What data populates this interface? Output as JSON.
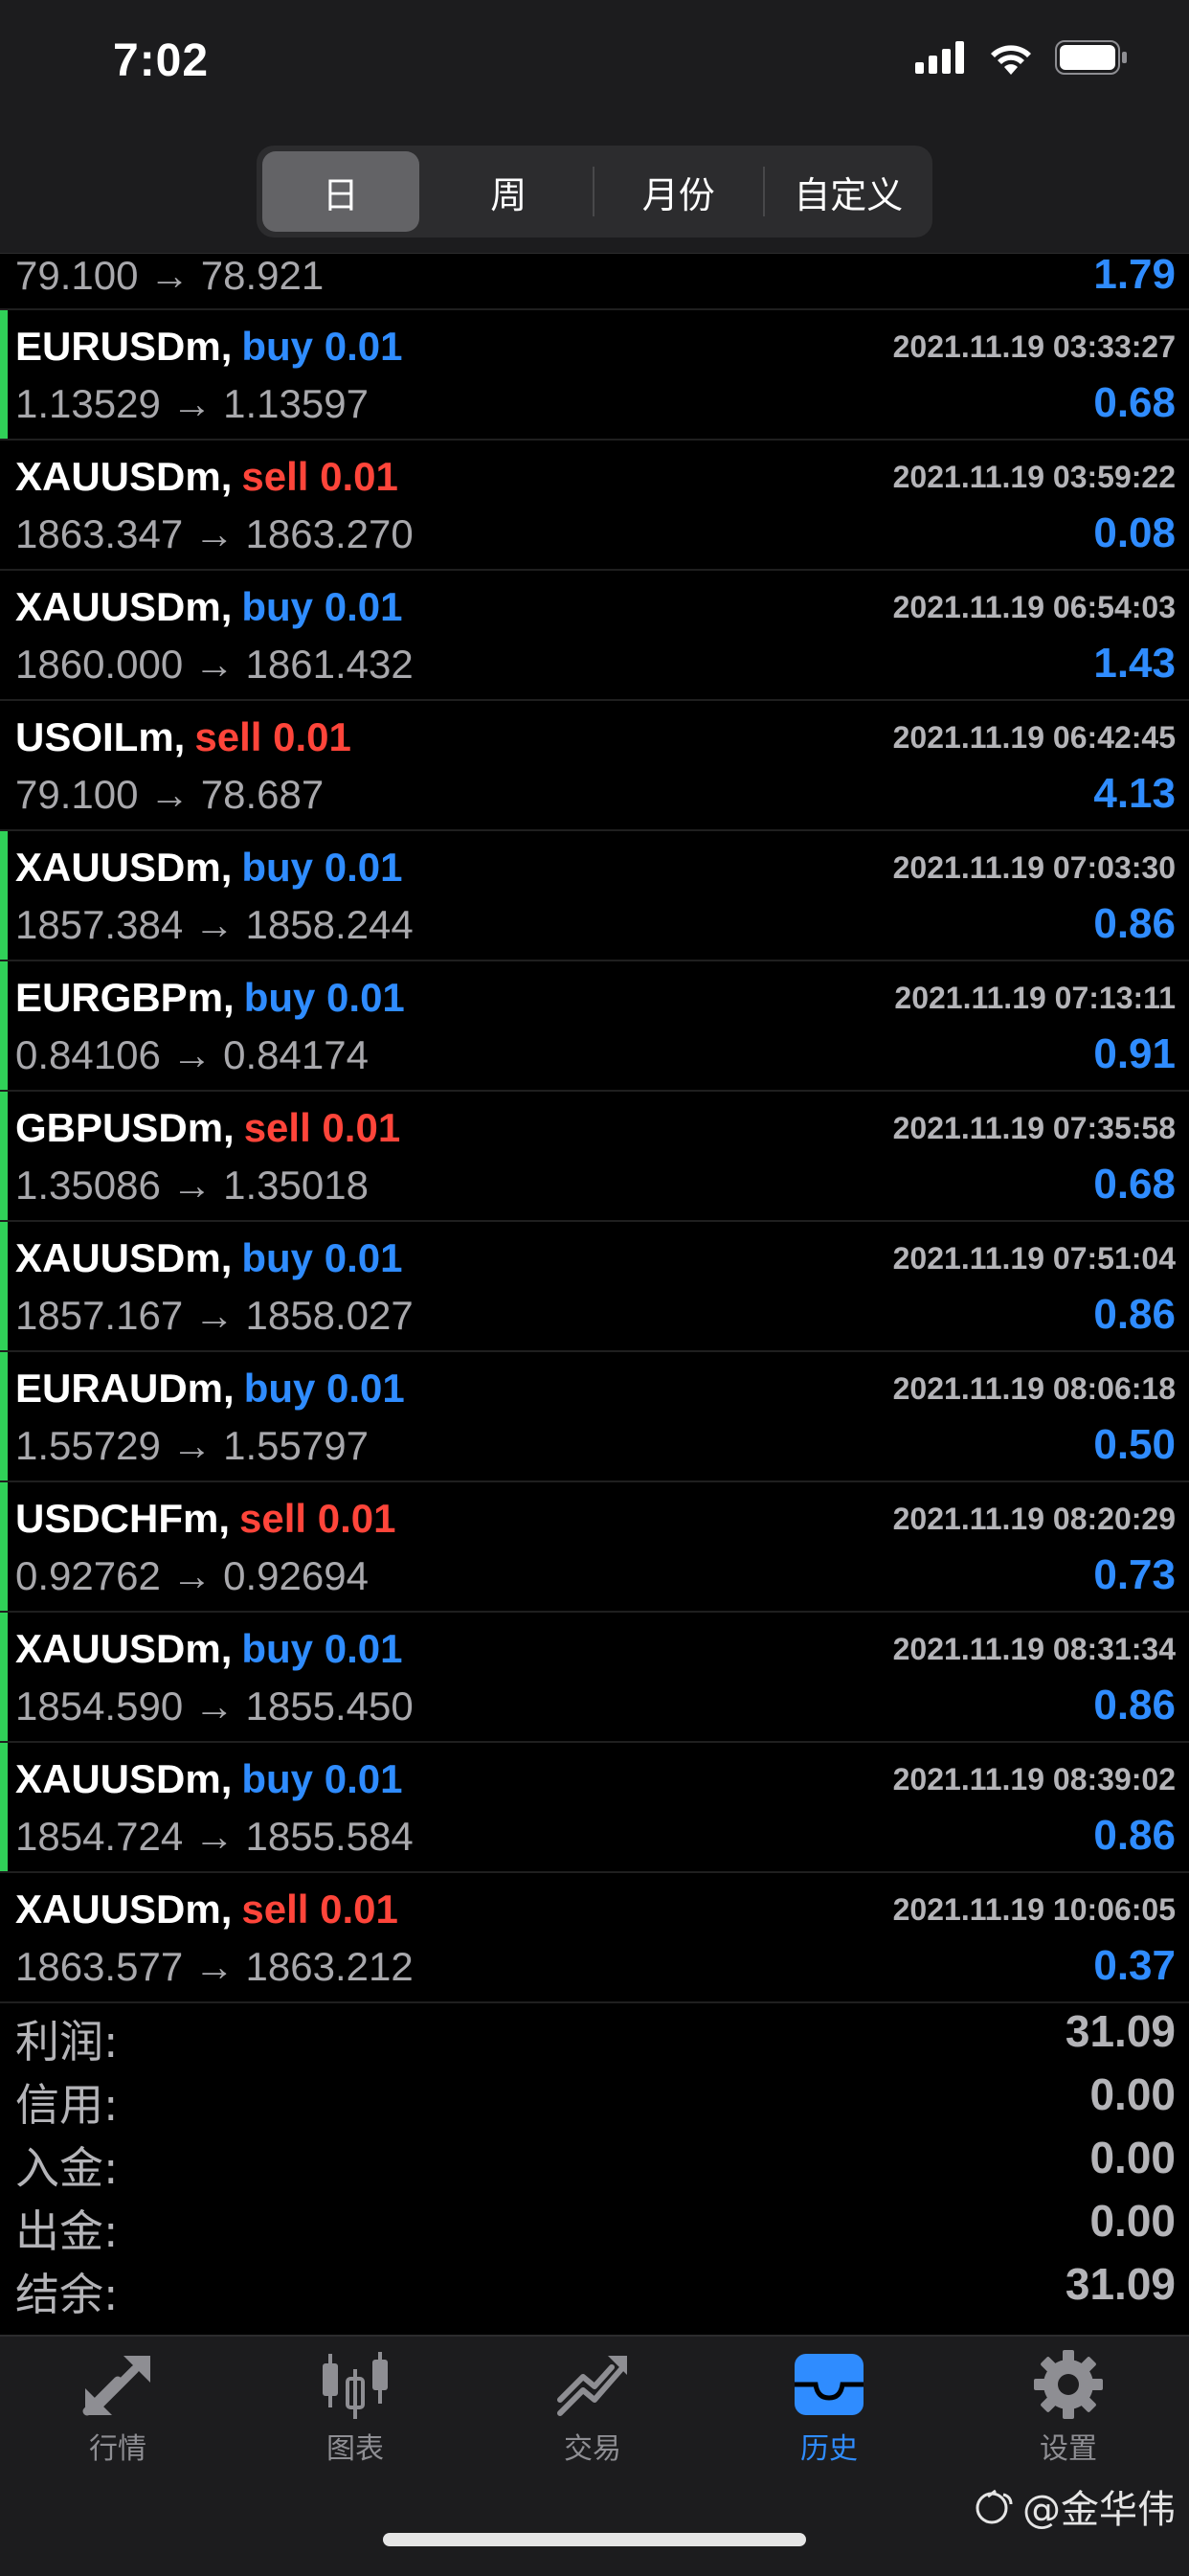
{
  "status_bar": {
    "time": "7:02"
  },
  "period_tabs": [
    {
      "label": "日",
      "active": true
    },
    {
      "label": "周",
      "active": false
    },
    {
      "label": "月份",
      "active": false
    },
    {
      "label": "自定义",
      "active": false
    }
  ],
  "partial_row": {
    "prices": "79.100 → 78.921",
    "profit": "1.79"
  },
  "trades": [
    {
      "symbol": "EURUSDm,",
      "side": "buy 0.01",
      "type": "buy",
      "time": "2021.11.19 03:33:27",
      "prices": "1.13529 → 1.13597",
      "profit": "0.68",
      "marker": true
    },
    {
      "symbol": "XAUUSDm,",
      "side": "sell 0.01",
      "type": "sell",
      "time": "2021.11.19 03:59:22",
      "prices": "1863.347 → 1863.270",
      "profit": "0.08",
      "marker": false
    },
    {
      "symbol": "XAUUSDm,",
      "side": "buy 0.01",
      "type": "buy",
      "time": "2021.11.19 06:54:03",
      "prices": "1860.000 → 1861.432",
      "profit": "1.43",
      "marker": false
    },
    {
      "symbol": "USOILm,",
      "side": "sell 0.01",
      "type": "sell",
      "time": "2021.11.19 06:42:45",
      "prices": "79.100 → 78.687",
      "profit": "4.13",
      "marker": false
    },
    {
      "symbol": "XAUUSDm,",
      "side": "buy 0.01",
      "type": "buy",
      "time": "2021.11.19 07:03:30",
      "prices": "1857.384 → 1858.244",
      "profit": "0.86",
      "marker": true
    },
    {
      "symbol": "EURGBPm,",
      "side": "buy 0.01",
      "type": "buy",
      "time": "2021.11.19 07:13:11",
      "prices": "0.84106 → 0.84174",
      "profit": "0.91",
      "marker": true
    },
    {
      "symbol": "GBPUSDm,",
      "side": "sell 0.01",
      "type": "sell",
      "time": "2021.11.19 07:35:58",
      "prices": "1.35086 → 1.35018",
      "profit": "0.68",
      "marker": true
    },
    {
      "symbol": "XAUUSDm,",
      "side": "buy 0.01",
      "type": "buy",
      "time": "2021.11.19 07:51:04",
      "prices": "1857.167 → 1858.027",
      "profit": "0.86",
      "marker": true
    },
    {
      "symbol": "EURAUDm,",
      "side": "buy 0.01",
      "type": "buy",
      "time": "2021.11.19 08:06:18",
      "prices": "1.55729 → 1.55797",
      "profit": "0.50",
      "marker": true
    },
    {
      "symbol": "USDCHFm,",
      "side": "sell 0.01",
      "type": "sell",
      "time": "2021.11.19 08:20:29",
      "prices": "0.92762 → 0.92694",
      "profit": "0.73",
      "marker": true
    },
    {
      "symbol": "XAUUSDm,",
      "side": "buy 0.01",
      "type": "buy",
      "time": "2021.11.19 08:31:34",
      "prices": "1854.590 → 1855.450",
      "profit": "0.86",
      "marker": true
    },
    {
      "symbol": "XAUUSDm,",
      "side": "buy 0.01",
      "type": "buy",
      "time": "2021.11.19 08:39:02",
      "prices": "1854.724 → 1855.584",
      "profit": "0.86",
      "marker": true
    },
    {
      "symbol": "XAUUSDm,",
      "side": "sell 0.01",
      "type": "sell",
      "time": "2021.11.19 10:06:05",
      "prices": "1863.577 → 1863.212",
      "profit": "0.37",
      "marker": false
    }
  ],
  "summary": [
    {
      "label": "利润:",
      "value": "31.09"
    },
    {
      "label": "信用:",
      "value": "0.00"
    },
    {
      "label": "入金:",
      "value": "0.00"
    },
    {
      "label": "出金:",
      "value": "0.00"
    },
    {
      "label": "结余:",
      "value": "31.09"
    }
  ],
  "tab_bar": [
    {
      "label": "行情",
      "icon": "quotes-arrows-icon",
      "active": false
    },
    {
      "label": "图表",
      "icon": "candlestick-chart-icon",
      "active": false
    },
    {
      "label": "交易",
      "icon": "trade-trend-icon",
      "active": false
    },
    {
      "label": "历史",
      "icon": "history-tray-icon",
      "active": true
    },
    {
      "label": "设置",
      "icon": "gear-icon",
      "active": false
    }
  ],
  "watermark": "@金华伟",
  "colors": {
    "buy": "#2f8cff",
    "sell": "#ff453a",
    "marker": "#30d158",
    "active_tab": "#2f8cff"
  }
}
